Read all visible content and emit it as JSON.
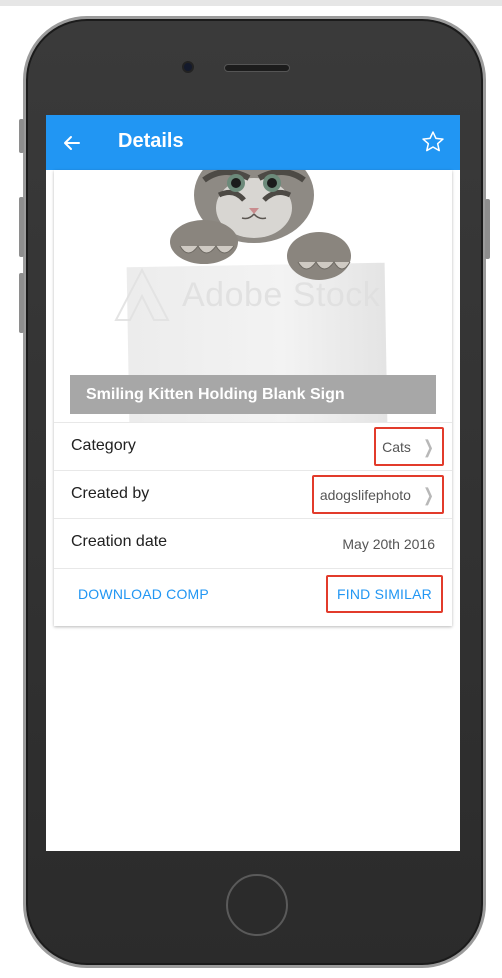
{
  "appbar": {
    "title": "Details",
    "back_icon": "arrow-left-icon",
    "star_icon": "star-outline-icon",
    "color": "#2196f3"
  },
  "image": {
    "caption": "Smiling Kitten Holding Blank Sign",
    "watermark": "Adobe Stock"
  },
  "details": {
    "category": {
      "label": "Category",
      "value": "Cats"
    },
    "created_by": {
      "label": "Created by",
      "value": "adogslifephoto"
    },
    "creation_date": {
      "label": "Creation date",
      "value": "May 20th 2016"
    }
  },
  "actions": {
    "download": "DOWNLOAD COMP",
    "find_similar": "FIND SIMILAR"
  },
  "colors": {
    "highlight": "#e23b2b",
    "link": "#2196f3"
  }
}
